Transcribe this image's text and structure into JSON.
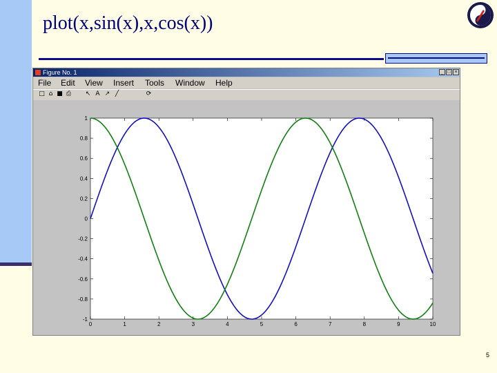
{
  "slide": {
    "title": "plot(x,sin(x),x,cos(x))",
    "page_number": "5"
  },
  "window": {
    "title": "Figure No. 1",
    "menu": [
      "File",
      "Edit",
      "View",
      "Insert",
      "Tools",
      "Window",
      "Help"
    ],
    "toolbar_icons": [
      "new-file-icon",
      "open-folder-icon",
      "save-icon",
      "print-icon",
      "arrow-select-icon",
      "text-insert-icon",
      "arrow-insert-icon",
      "line-insert-icon",
      "rotate-icon"
    ],
    "toolbar_glyphs": [
      "□",
      "⌂",
      "■",
      "⎙",
      "↖",
      "A",
      "↗",
      "╱",
      "⟳"
    ],
    "controls": [
      "_",
      "□",
      "×"
    ]
  },
  "chart_data": {
    "type": "line",
    "title": "",
    "xlabel": "",
    "ylabel": "",
    "xlim": [
      0,
      10
    ],
    "ylim": [
      -1,
      1
    ],
    "x_ticks": [
      "0",
      "1",
      "2",
      "3",
      "4",
      "5",
      "6",
      "7",
      "8",
      "9",
      "10"
    ],
    "y_ticks": [
      "1",
      "0.8",
      "0.6",
      "0.4",
      "0.2",
      "0",
      "-0.2",
      "-0.4",
      "-0.6",
      "-0.8",
      "-1"
    ],
    "grid": false,
    "legend": "none",
    "x": [
      0,
      0.5,
      1,
      1.5,
      2,
      2.5,
      3,
      3.5,
      4,
      4.5,
      5,
      5.5,
      6,
      6.5,
      7,
      7.5,
      8,
      8.5,
      9,
      9.5,
      10
    ],
    "series": [
      {
        "color": "#1010c0",
        "values": [
          0,
          0.479,
          0.841,
          0.997,
          0.909,
          0.598,
          0.141,
          -0.351,
          -0.757,
          -0.978,
          -0.959,
          -0.706,
          -0.279,
          0.215,
          0.657,
          0.938,
          0.989,
          0.798,
          0.412,
          -0.075,
          -0.544
        ]
      },
      {
        "color": "#108010",
        "values": [
          1,
          0.878,
          0.54,
          0.071,
          -0.416,
          -0.801,
          -0.99,
          -0.936,
          -0.654,
          -0.211,
          0.284,
          0.709,
          0.96,
          0.977,
          0.754,
          0.347,
          -0.146,
          -0.602,
          -0.911,
          -0.997,
          -0.839
        ]
      }
    ]
  },
  "colors": {
    "accent_blue": "#a6c9f5",
    "title_color": "#00007a",
    "rule_color": "#0a0a8a"
  }
}
